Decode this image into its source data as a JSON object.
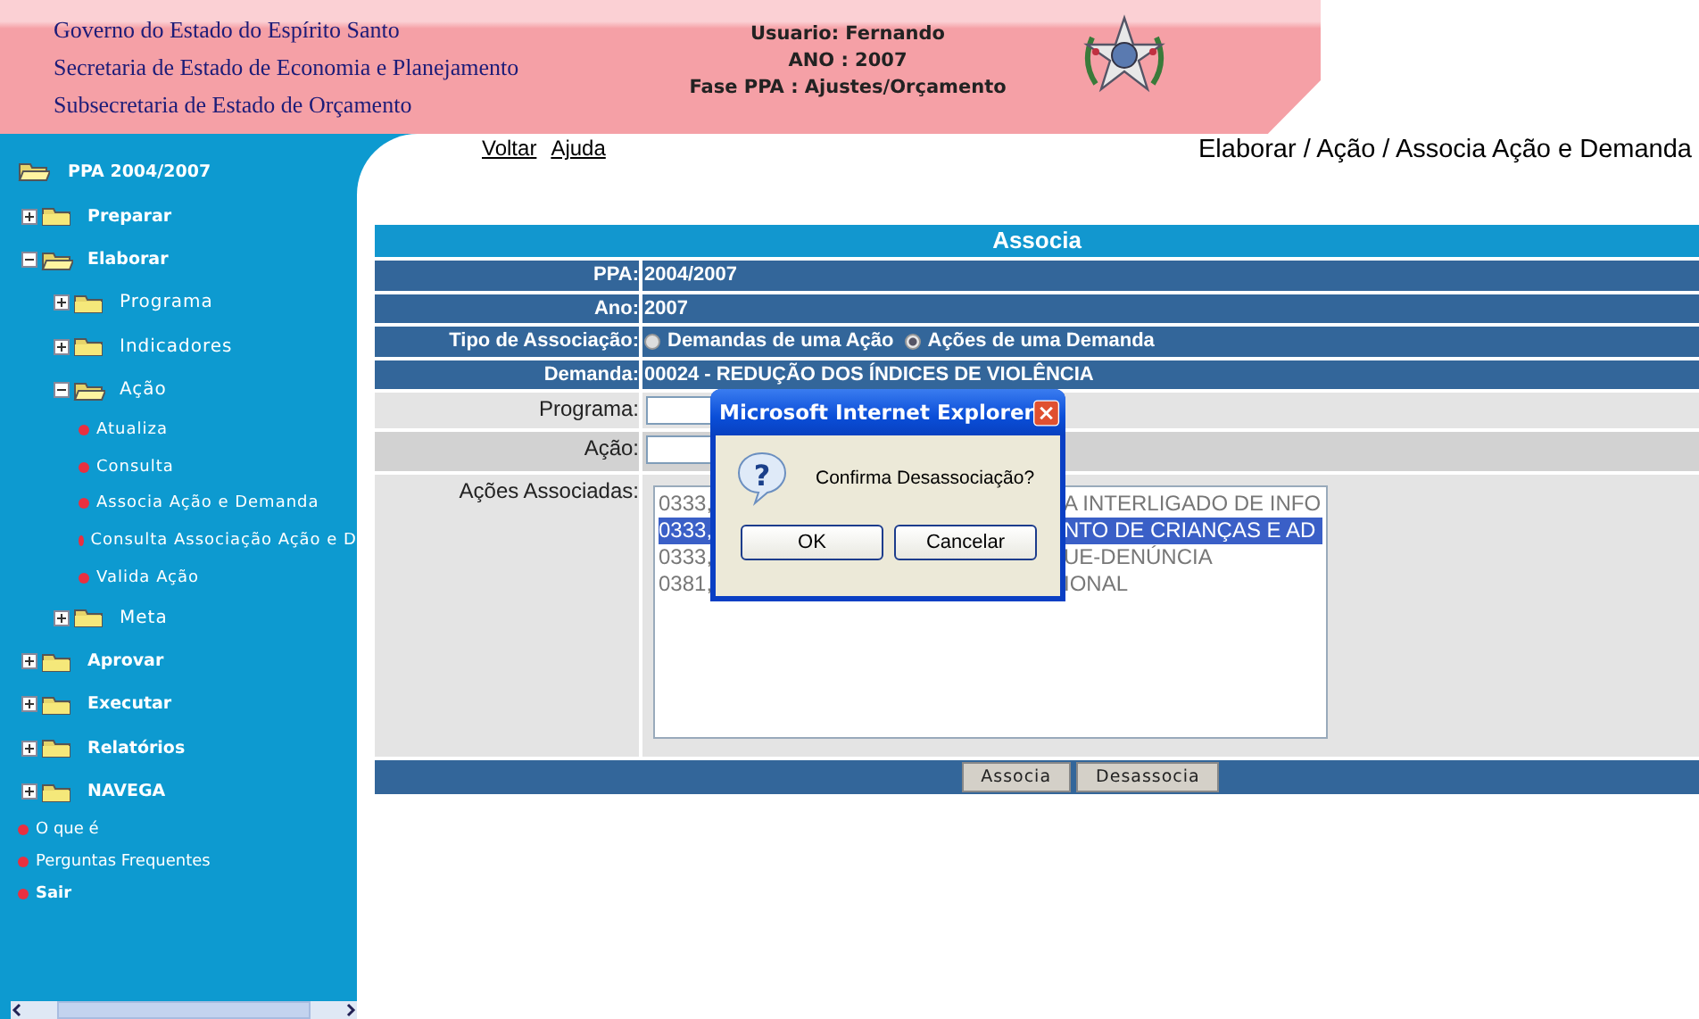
{
  "header": {
    "lines": [
      "Governo do Estado do Espírito Santo",
      "Secretaria de Estado de Economia e Planejamento",
      "Subsecretaria de Estado de Orçamento"
    ],
    "user_info": [
      "Usuario: Fernando",
      "ANO : 2007",
      "Fase PPA : Ajustes/Orçamento"
    ]
  },
  "sidebar": {
    "root": {
      "label": "PPA 2004/2007"
    },
    "items": [
      {
        "label": "Preparar",
        "kind": "folder",
        "expanded": false
      },
      {
        "label": "Elaborar",
        "kind": "folder",
        "expanded": true,
        "children": [
          {
            "label": "Programa",
            "kind": "folder",
            "expanded": false
          },
          {
            "label": "Indicadores",
            "kind": "folder",
            "expanded": false
          },
          {
            "label": "Ação",
            "kind": "folder",
            "expanded": true,
            "children": [
              {
                "label": "Atualiza",
                "kind": "link"
              },
              {
                "label": "Consulta",
                "kind": "link"
              },
              {
                "label": "Associa Ação e Demanda",
                "kind": "link"
              },
              {
                "label": "Consulta Associação Ação e D",
                "kind": "link"
              },
              {
                "label": "Valida Ação",
                "kind": "link"
              }
            ]
          },
          {
            "label": "Meta",
            "kind": "folder",
            "expanded": false
          }
        ]
      },
      {
        "label": "Aprovar",
        "kind": "folder",
        "expanded": false
      },
      {
        "label": "Executar",
        "kind": "folder",
        "expanded": false
      },
      {
        "label": "Relatórios",
        "kind": "folder",
        "expanded": false
      },
      {
        "label": "NAVEGA",
        "kind": "folder",
        "expanded": false
      }
    ],
    "links": [
      {
        "label": "O que é",
        "bold": false
      },
      {
        "label": "Perguntas Frequentes",
        "bold": false
      },
      {
        "label": "Sair",
        "bold": true
      }
    ]
  },
  "nav_links": [
    "Voltar",
    "Ajuda"
  ],
  "breadcrumb": "Elaborar / Ação / Associa Ação e Demanda",
  "form": {
    "title": "Associa",
    "info_rows": [
      {
        "label": "PPA:",
        "value": "2004/2007"
      },
      {
        "label": "Ano:",
        "value": "2007"
      }
    ],
    "association_type": {
      "label": "Tipo de Associação:",
      "options": [
        {
          "label": "Demandas de uma Ação",
          "selected": false
        },
        {
          "label": "Ações de uma Demanda",
          "selected": true
        }
      ]
    },
    "demand": {
      "label": "Demanda:",
      "value": "00024 - REDUÇÃO DOS ÍNDICES DE VIOLÊNCIA"
    },
    "programa": {
      "label": "Programa:"
    },
    "acao": {
      "label": "Ação:"
    },
    "associated": {
      "label": "Ações Associadas:",
      "items": [
        {
          "start": "0333,",
          "end": "A INTERLIGADO DE INFO",
          "selected": false
        },
        {
          "start": "0333,",
          "end": "NTO DE CRIANÇAS E AD",
          "selected": true
        },
        {
          "start": "0333,",
          "end": "UE-DENÚNCIA",
          "selected": false
        },
        {
          "start": "0381,",
          "end": "IONAL",
          "selected": false
        }
      ]
    },
    "buttons": [
      "Associa",
      "Desassocia"
    ]
  },
  "dialog": {
    "title": "Microsoft Internet Explorer",
    "icon": "?",
    "message": "Confirma Desassociação?",
    "buttons": [
      "OK",
      "Cancelar"
    ]
  }
}
